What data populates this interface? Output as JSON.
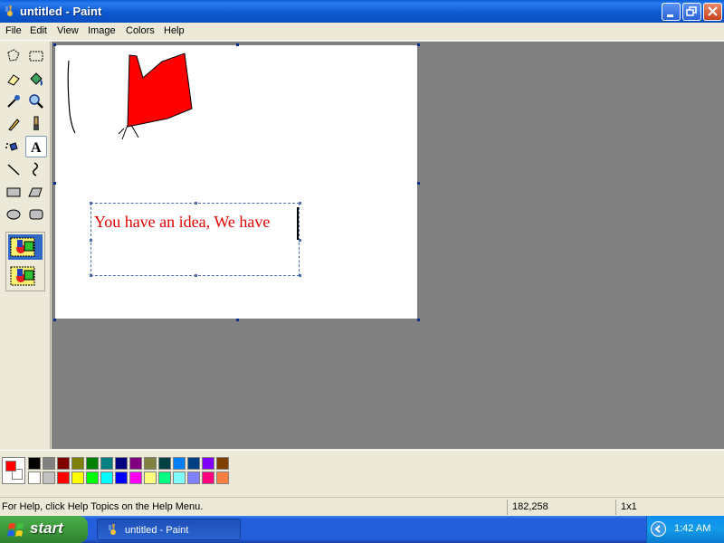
{
  "window": {
    "title": "untitled - Paint",
    "icon": "paint-icon",
    "controls": [
      "minimize-icon",
      "restore-icon",
      "close-icon"
    ]
  },
  "menu": [
    "File",
    "Edit",
    "View",
    "Image",
    "Colors",
    "Help"
  ],
  "tools": [
    {
      "name": "free-form-select",
      "icon": "free-form-select-icon"
    },
    {
      "name": "select",
      "icon": "select-icon"
    },
    {
      "name": "eraser",
      "icon": "eraser-icon"
    },
    {
      "name": "fill-with-color",
      "icon": "fill-bucket-icon"
    },
    {
      "name": "pick-color",
      "icon": "eyedropper-icon"
    },
    {
      "name": "magnifier",
      "icon": "magnifier-icon"
    },
    {
      "name": "pencil",
      "icon": "pencil-icon"
    },
    {
      "name": "brush",
      "icon": "brush-icon"
    },
    {
      "name": "airbrush",
      "icon": "airbrush-icon"
    },
    {
      "name": "text",
      "icon": "text-icon",
      "active": true
    },
    {
      "name": "line",
      "icon": "line-icon"
    },
    {
      "name": "curve",
      "icon": "curve-icon"
    },
    {
      "name": "rectangle",
      "icon": "rectangle-icon"
    },
    {
      "name": "polygon",
      "icon": "polygon-icon"
    },
    {
      "name": "ellipse",
      "icon": "ellipse-icon"
    },
    {
      "name": "rounded-rectangle",
      "icon": "rounded-rectangle-icon"
    }
  ],
  "canvas": {
    "text_box_content": "You have an idea, We have",
    "text_color": "#e00000",
    "drawing_fill": "#ff0000"
  },
  "colors": {
    "foreground": "#ff0000",
    "background": "#ffffff",
    "palette_row1": [
      "#000000",
      "#808080",
      "#800000",
      "#808000",
      "#008000",
      "#008080",
      "#000080",
      "#800080",
      "#808040",
      "#004040",
      "#0080ff",
      "#004080",
      "#8000ff",
      "#804000"
    ],
    "palette_row2": [
      "#ffffff",
      "#c0c0c0",
      "#ff0000",
      "#ffff00",
      "#00ff00",
      "#00ffff",
      "#0000ff",
      "#ff00ff",
      "#ffff80",
      "#00ff80",
      "#80ffff",
      "#8080ff",
      "#ff0080",
      "#ff8040"
    ]
  },
  "status": {
    "help": "For Help, click Help Topics on the Help Menu.",
    "coordinates": "182,258",
    "size": "1x1"
  },
  "taskbar": {
    "start_label": "start",
    "task_label": "untitled - Paint",
    "clock": "1:42 AM"
  }
}
